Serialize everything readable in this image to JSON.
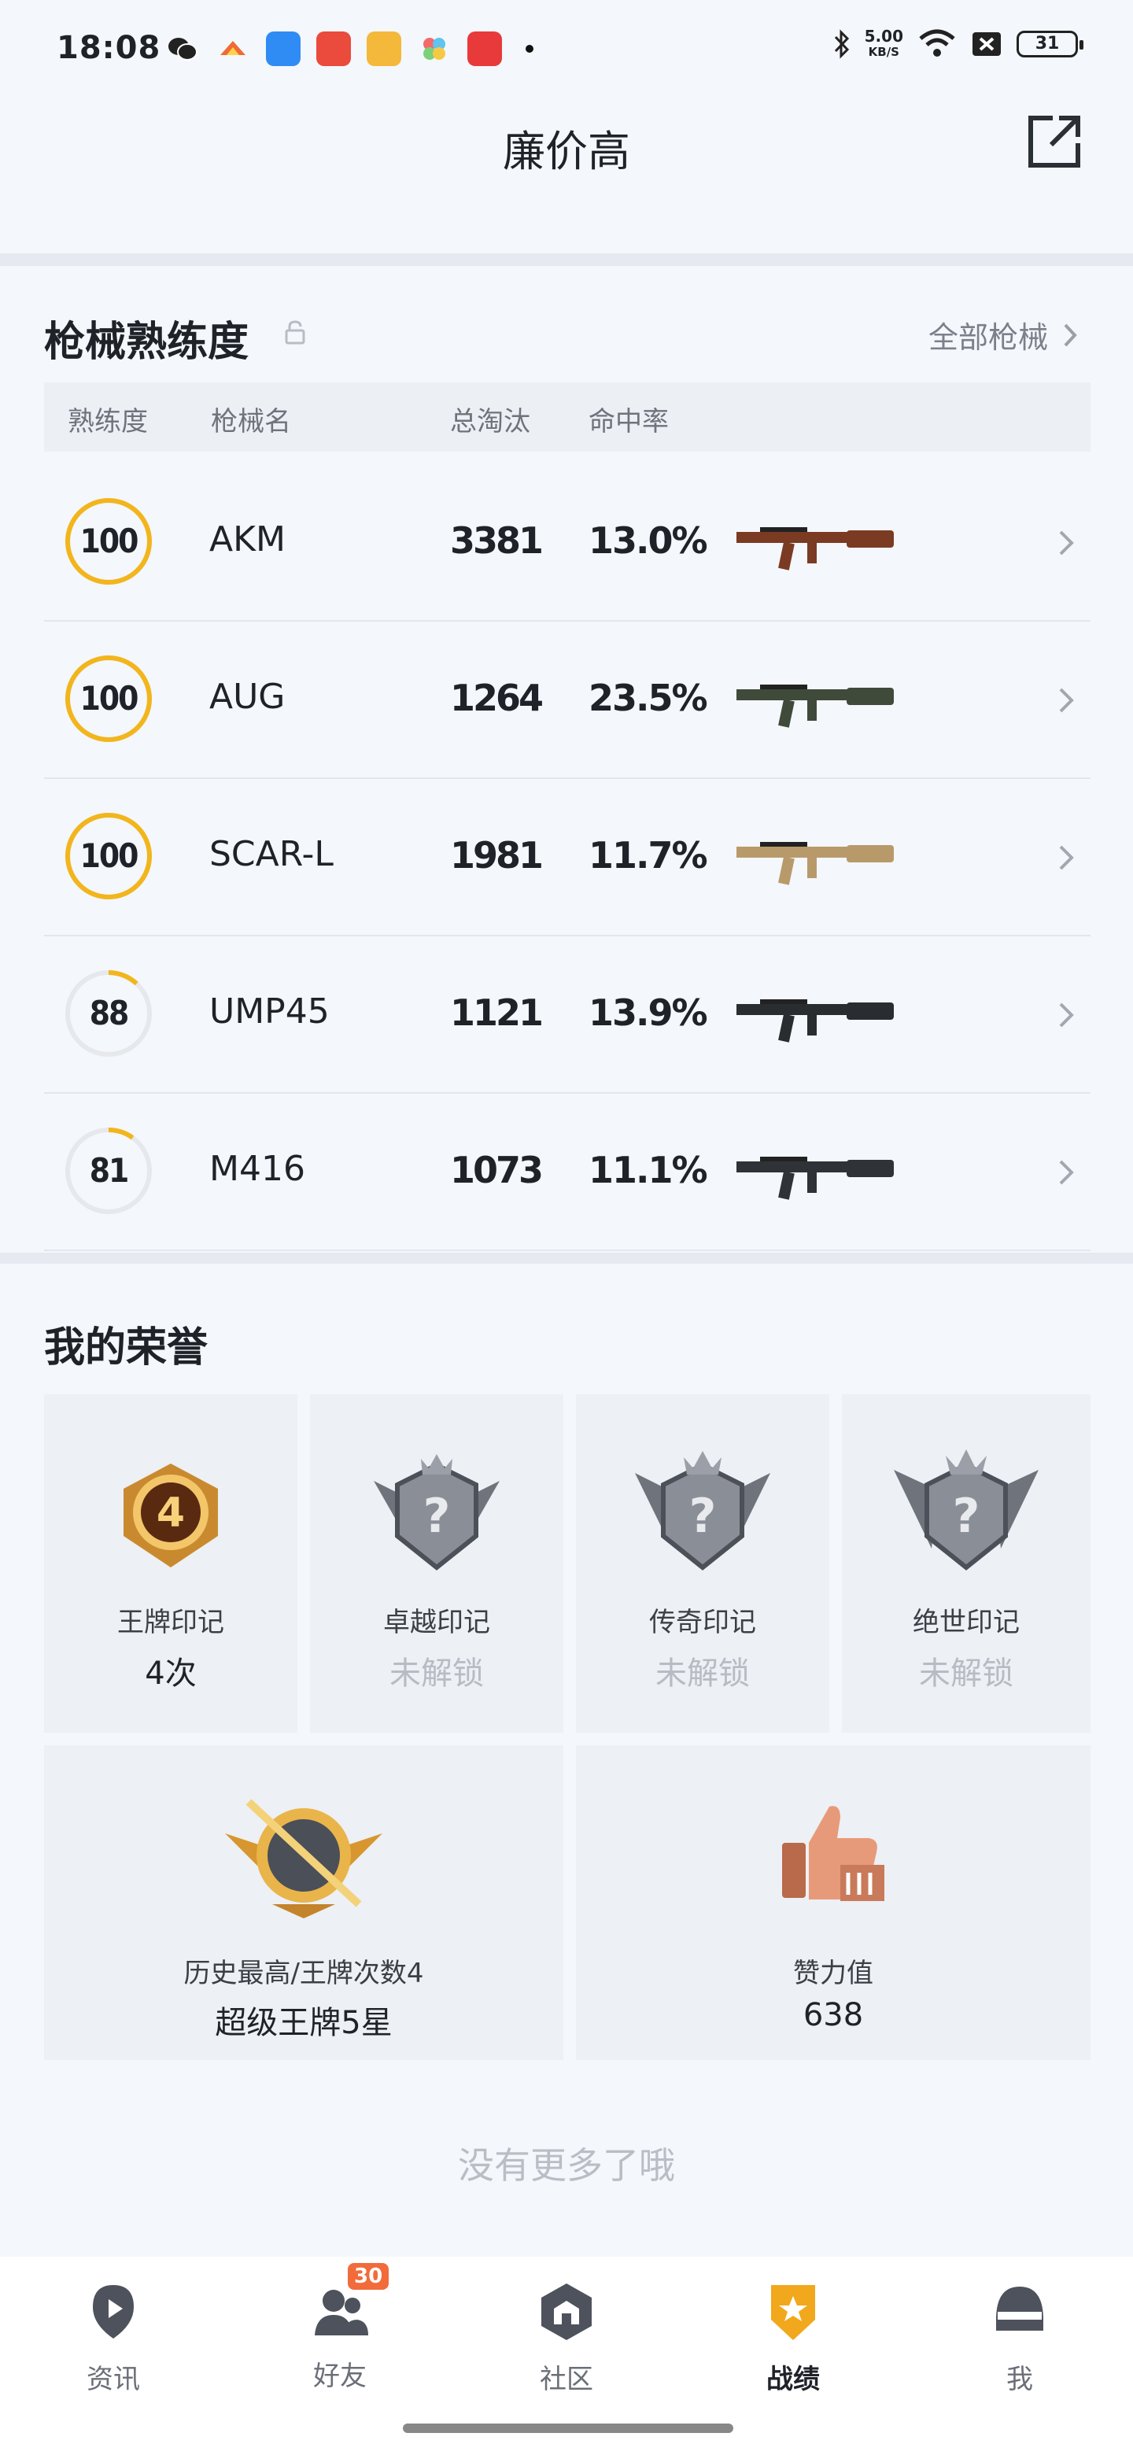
{
  "status_bar": {
    "time": "18:08",
    "net_speed": "5.00",
    "net_unit": "KB/S",
    "battery": "31"
  },
  "header": {
    "title": "廉价高",
    "share_icon": "external-share-icon"
  },
  "weapons": {
    "title": "枪械熟练度",
    "all_link": "全部枪械",
    "columns": [
      "熟练度",
      "枪械名",
      "总淘汰",
      "命中率"
    ],
    "rows": [
      {
        "mastery": "100",
        "mastery_level": 1.0,
        "name": "AKM",
        "kills": "3381",
        "accuracy": "13.0%",
        "gun_icon": "akm-rifle-icon"
      },
      {
        "mastery": "100",
        "mastery_level": 1.0,
        "name": "AUG",
        "kills": "1264",
        "accuracy": "23.5%",
        "gun_icon": "aug-rifle-icon"
      },
      {
        "mastery": "100",
        "mastery_level": 1.0,
        "name": "SCAR-L",
        "kills": "1981",
        "accuracy": "11.7%",
        "gun_icon": "scar-l-rifle-icon"
      },
      {
        "mastery": "88",
        "mastery_level": 0.12,
        "name": "UMP45",
        "kills": "1121",
        "accuracy": "13.9%",
        "gun_icon": "ump45-smg-icon"
      },
      {
        "mastery": "81",
        "mastery_level": 0.1,
        "name": "M416",
        "kills": "1073",
        "accuracy": "11.1%",
        "gun_icon": "m416-rifle-icon"
      }
    ]
  },
  "honors": {
    "title": "我的荣誉",
    "cards": [
      {
        "label": "王牌印记",
        "value": "4次",
        "unlocked": true
      },
      {
        "label": "卓越印记",
        "value": "未解锁",
        "unlocked": false
      },
      {
        "label": "传奇印记",
        "value": "未解锁",
        "unlocked": false
      },
      {
        "label": "绝世印记",
        "value": "未解锁",
        "unlocked": false
      }
    ],
    "wide_cards": [
      {
        "label": "历史最高/王牌次数4",
        "value": "超级王牌5星"
      },
      {
        "label": "赞力值",
        "value": "638"
      }
    ]
  },
  "footer_note": "没有更多了哦",
  "nav": {
    "items": [
      {
        "label": "资讯",
        "icon": "news-icon"
      },
      {
        "label": "好友",
        "icon": "friends-icon",
        "badge": "30"
      },
      {
        "label": "社区",
        "icon": "community-icon"
      },
      {
        "label": "战绩",
        "icon": "record-icon",
        "active": true
      },
      {
        "label": "我",
        "icon": "profile-helmet-icon"
      }
    ]
  },
  "colors": {
    "mastery_ring": "#f2b51c",
    "ring_track": "#e6e8ec",
    "active_nav": "#f2a81c"
  }
}
